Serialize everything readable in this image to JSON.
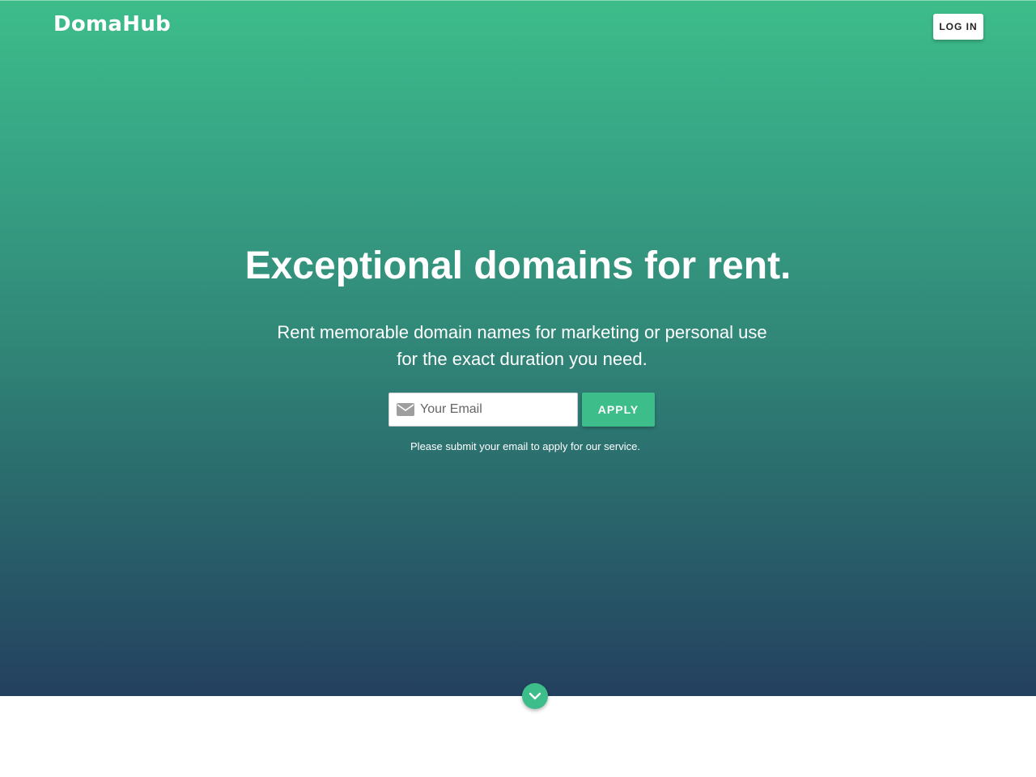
{
  "header": {
    "logo_text": "DomaHub",
    "login_label": "LOG IN"
  },
  "hero": {
    "headline": "Exceptional domains for rent.",
    "subheadline": "Rent memorable domain names for marketing or personal use for the exact duration you need.",
    "email": {
      "icon": "envelope-icon",
      "placeholder": "Your Email",
      "value": ""
    },
    "apply_label": "APPLY",
    "note": "Please submit your email to apply for our service.",
    "scroll_icon": "chevron-down-icon"
  },
  "colors": {
    "brand_green": "#3dbd8a",
    "gradient_top": "#3dbd8a",
    "gradient_bottom": "#24405f",
    "background": "#ffffff"
  }
}
